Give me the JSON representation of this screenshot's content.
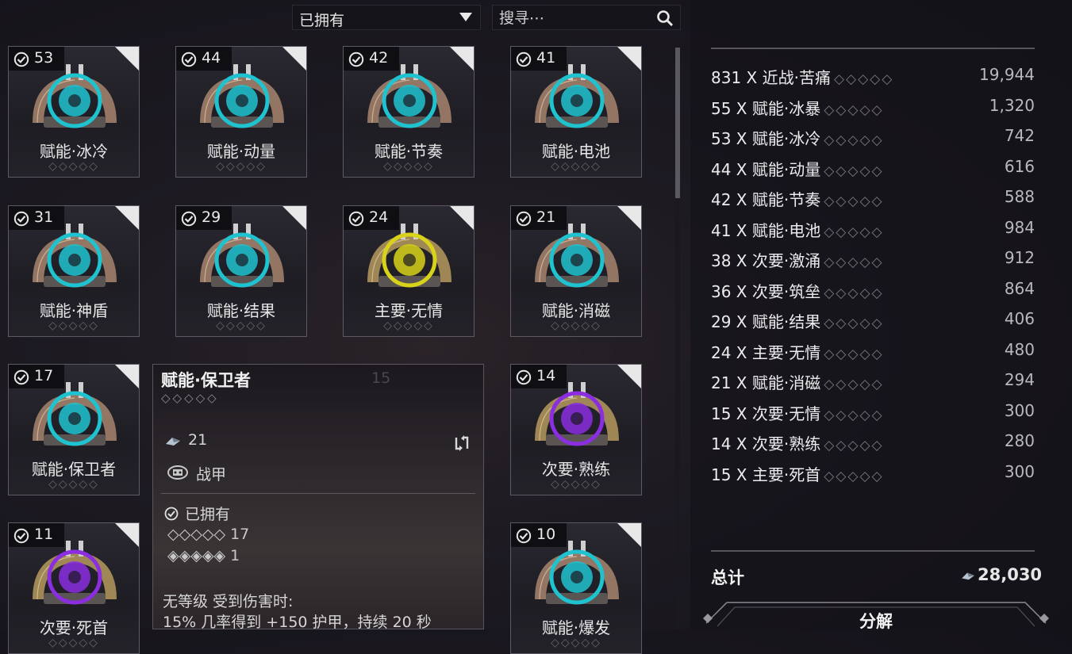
{
  "toolbar": {
    "filter_label": "已拥有",
    "search_placeholder": "搜寻⋯"
  },
  "colors": {
    "cyan": "#1fc3d0",
    "yellow": "#d8d21a",
    "purple": "#8a2ee0",
    "gold": "#b9975a"
  },
  "grid": {
    "cards": [
      {
        "count": "53",
        "name": "赋能·冰冷",
        "rank": "◇◇◇◇◇",
        "color": "#1fc3d0",
        "icon": "flame-icon"
      },
      {
        "count": "44",
        "name": "赋能·动量",
        "rank": "◇◇◇◇◇",
        "color": "#1fc3d0",
        "icon": "swirl-icon"
      },
      {
        "count": "42",
        "name": "赋能·节奏",
        "rank": "◇◇◇◇◇",
        "color": "#1fc3d0",
        "icon": "nautilus-icon"
      },
      {
        "count": "41",
        "name": "赋能·电池",
        "rank": "◇◇◇◇◇",
        "color": "#1fc3d0",
        "icon": "mask-icon"
      },
      {
        "count": "31",
        "name": "赋能·神盾",
        "rank": "◇◇◇◇◇",
        "color": "#1fc3d0",
        "icon": "shield-icon"
      },
      {
        "count": "29",
        "name": "赋能·结果",
        "rank": "◇◇◇◇◇",
        "color": "#1fc3d0",
        "icon": "ring-icon"
      },
      {
        "count": "24",
        "name": "主要·无情",
        "rank": "◇◇◇◇◇",
        "color": "#d8d21a",
        "icon": "flower-icon"
      },
      {
        "count": "21",
        "name": "赋能·消磁",
        "rank": "◇◇◇◇◇",
        "color": "#1fc3d0",
        "icon": "magnet-icon"
      },
      {
        "count": "17",
        "name": "赋能·保卫者",
        "rank": "◇◇◇◇◇",
        "color": "#1fc3d0",
        "icon": "cross-icon"
      },
      {
        "count": "14",
        "name": "次要·熟练",
        "rank": "◇◇◇◇◇",
        "color": "#8a2ee0",
        "icon": "target-icon"
      },
      {
        "count": "11",
        "name": "次要·死首",
        "rank": "◇◇◇◇◇",
        "color": "#8a2ee0",
        "icon": "skull-icon"
      },
      {
        "count": "10",
        "name": "赋能·爆发",
        "rank": "◇◇◇◇◇",
        "color": "#1fc3d0",
        "icon": "burst-icon"
      }
    ],
    "hidden_count": "15"
  },
  "tooltip": {
    "title": "赋能·保卫者",
    "rank": "◇◇◇◇◇",
    "endo": "21",
    "category": "战甲",
    "owned_label": "已拥有",
    "unranked": "◇◇◇◇◇ 17",
    "maxed": "◈◈◈◈◈ 1",
    "desc_line1": "无等级  受到伤害时:",
    "desc_line2": "15% 几率得到 +150 护甲，持续 20 秒"
  },
  "summary": {
    "rows": [
      {
        "label": "831 X 近战·苦痛",
        "rank": "◇◇◇◇◇",
        "value": "19,944"
      },
      {
        "label": "55 X 赋能·冰暴",
        "rank": "◇◇◇◇◇",
        "value": "1,320"
      },
      {
        "label": "53 X 赋能·冰冷",
        "rank": "◇◇◇◇◇",
        "value": "742"
      },
      {
        "label": "44 X 赋能·动量",
        "rank": "◇◇◇◇◇",
        "value": "616"
      },
      {
        "label": "42 X 赋能·节奏",
        "rank": "◇◇◇◇◇",
        "value": "588"
      },
      {
        "label": "41 X 赋能·电池",
        "rank": "◇◇◇◇◇",
        "value": "984"
      },
      {
        "label": "38 X 次要·激涌",
        "rank": "◇◇◇◇◇",
        "value": "912"
      },
      {
        "label": "36 X 次要·筑垒",
        "rank": "◇◇◇◇◇",
        "value": "864"
      },
      {
        "label": "29 X 赋能·结果",
        "rank": "◇◇◇◇◇",
        "value": "406"
      },
      {
        "label": "24 X 主要·无情",
        "rank": "◇◇◇◇◇",
        "value": "480"
      },
      {
        "label": "21 X 赋能·消磁",
        "rank": "◇◇◇◇◇",
        "value": "294"
      },
      {
        "label": "15 X 次要·无情",
        "rank": "◇◇◇◇◇",
        "value": "300"
      },
      {
        "label": "14 X 次要·熟练",
        "rank": "◇◇◇◇◇",
        "value": "280"
      },
      {
        "label": "15 X 主要·死首",
        "rank": "◇◇◇◇◇",
        "value": "300"
      }
    ],
    "total_label": "总计",
    "total_value": "28,030",
    "dissolve_label": "分解"
  }
}
